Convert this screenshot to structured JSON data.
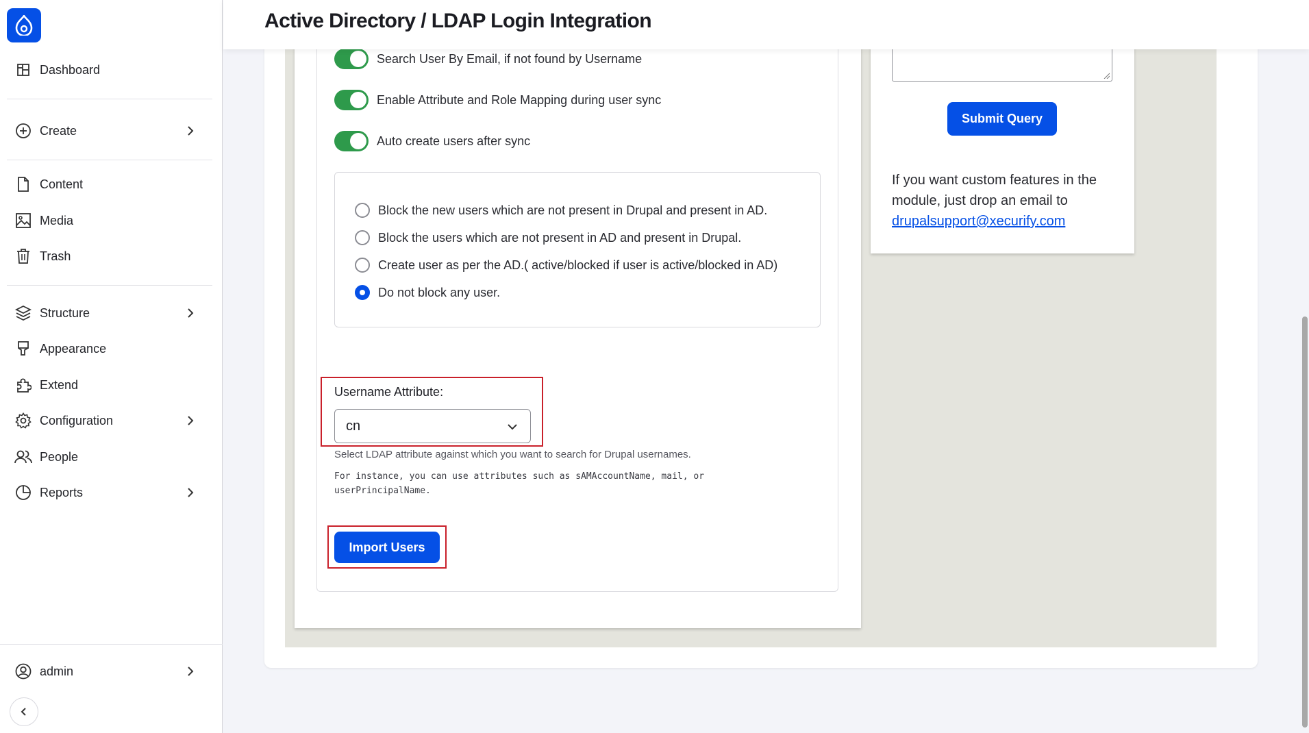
{
  "header": {
    "title": "Active Directory / LDAP Login Integration"
  },
  "sidebar": {
    "items": [
      {
        "label": "Dashboard",
        "icon": "dashboard-icon"
      },
      {
        "label": "Create",
        "icon": "plus-circle-icon",
        "expandable": true
      },
      {
        "label": "Content",
        "icon": "file-icon"
      },
      {
        "label": "Media",
        "icon": "image-icon"
      },
      {
        "label": "Trash",
        "icon": "trash-icon"
      },
      {
        "label": "Structure",
        "icon": "layers-icon",
        "expandable": true
      },
      {
        "label": "Appearance",
        "icon": "paint-brush-icon"
      },
      {
        "label": "Extend",
        "icon": "puzzle-icon"
      },
      {
        "label": "Configuration",
        "icon": "gear-icon",
        "expandable": true
      },
      {
        "label": "People",
        "icon": "people-icon"
      },
      {
        "label": "Reports",
        "icon": "pie-chart-icon",
        "expandable": true
      }
    ],
    "user": {
      "label": "admin",
      "icon": "user-circle-icon"
    }
  },
  "form": {
    "toggles": [
      {
        "label": "Search User By Email, if not found by Username",
        "on": true
      },
      {
        "label": "Enable Attribute and Role Mapping during user sync",
        "on": true
      },
      {
        "label": "Auto create users after sync",
        "on": true
      }
    ],
    "radios": [
      {
        "label": "Block the new users which are not present in Drupal and present in AD.",
        "checked": false
      },
      {
        "label": "Block the users which are not present in AD and present in Drupal.",
        "checked": false
      },
      {
        "label": "Create user as per the AD.( active/blocked if user is active/blocked in AD)",
        "checked": false
      },
      {
        "label": "Do not block any user.",
        "checked": true
      }
    ],
    "username_attribute": {
      "label": "Username Attribute:",
      "value": "cn",
      "help": "Select LDAP attribute against which you want to search for Drupal usernames.",
      "help_mono": "For instance, you can use attributes such as sAMAccountName, mail, or userPrincipalName."
    },
    "import_button": "Import Users"
  },
  "right_panel": {
    "submit_button": "Submit Query",
    "custom_text": "If you want custom features in the module, just drop an email to",
    "email": "drupalsupport@xecurify.com"
  },
  "colors": {
    "accent": "#0550e6",
    "toggle_on": "#2e9a4b",
    "highlight": "#c9202a"
  }
}
